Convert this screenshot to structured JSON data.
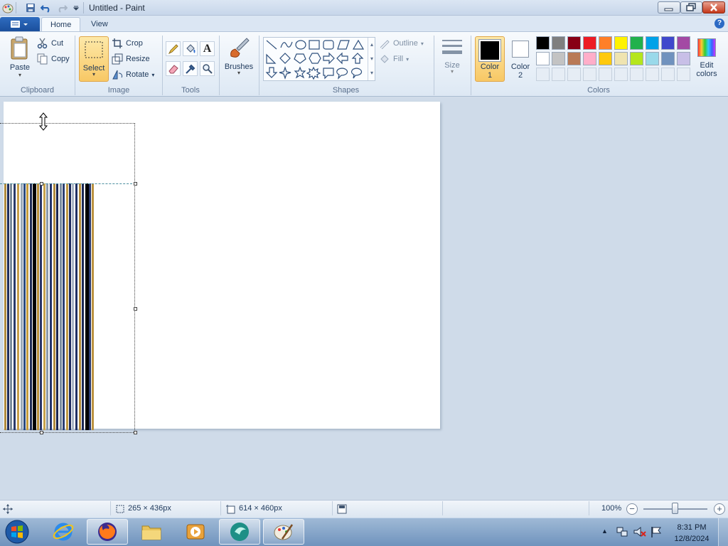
{
  "window": {
    "title": "Untitled - Paint"
  },
  "tabs": [
    {
      "label": "Home",
      "active": true
    },
    {
      "label": "View",
      "active": false
    }
  ],
  "clipboard": {
    "paste": "Paste",
    "cut": "Cut",
    "copy": "Copy",
    "group": "Clipboard"
  },
  "image": {
    "select": "Select",
    "crop": "Crop",
    "resize": "Resize",
    "rotate": "Rotate",
    "group": "Image"
  },
  "tools": {
    "group": "Tools",
    "items": [
      "pencil-icon",
      "fill-icon",
      "text-icon",
      "eraser-icon",
      "color-picker-icon",
      "magnifier-icon"
    ]
  },
  "brushes": {
    "label": "Brushes"
  },
  "shapes": {
    "group": "Shapes",
    "outline": "Outline",
    "fill": "Fill"
  },
  "size": {
    "label": "Size"
  },
  "color1": {
    "label_a": "Color",
    "label_b": "1",
    "value": "#000000"
  },
  "color2": {
    "label_a": "Color",
    "label_b": "2",
    "value": "#ffffff"
  },
  "colors": {
    "group": "Colors",
    "edit_a": "Edit",
    "edit_b": "colors",
    "row1": [
      "#000000",
      "#7f7f7f",
      "#880015",
      "#ed1c24",
      "#ff7f27",
      "#fff200",
      "#22b14c",
      "#00a2e8",
      "#3f48cc",
      "#a349a4"
    ],
    "row2": [
      "#ffffff",
      "#c3c3c3",
      "#b97a57",
      "#ffaec9",
      "#ffc90e",
      "#efe4b0",
      "#b5e61d",
      "#99d9ea",
      "#7092be",
      "#c8bfe7"
    ]
  },
  "status": {
    "selection_size": "265 × 436px",
    "image_size": "614 × 460px",
    "zoom": "100%"
  },
  "taskbar": {
    "time": "8:31 PM",
    "date": "12/8/2024"
  }
}
